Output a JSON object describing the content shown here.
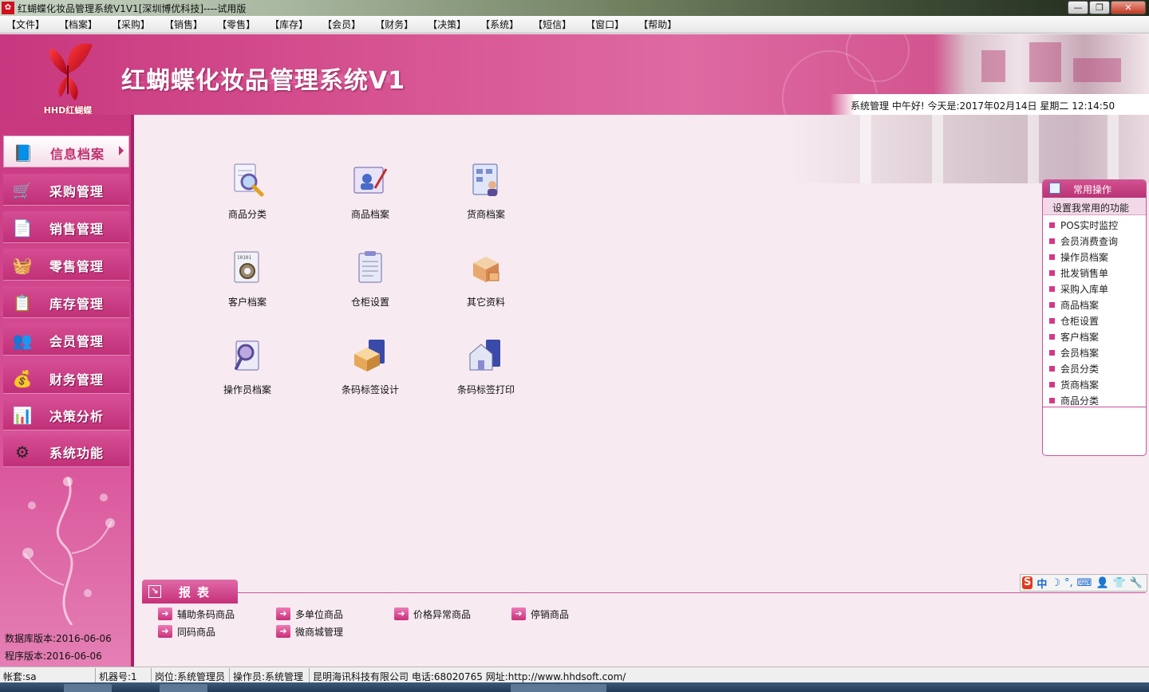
{
  "window": {
    "title": "红蝴蝶化妆品管理系统V1V1[深圳博优科技]----试用版",
    "minimize": "—",
    "maximize": "❐",
    "close": "✕"
  },
  "menubar": {
    "items": [
      "【文件】",
      "【档案】",
      "【采购】",
      "【销售】",
      "【零售】",
      "【库存】",
      "【会员】",
      "【财务】",
      "【决策】",
      "【系统】",
      "【短信】",
      "【窗口】",
      "【帮助】"
    ]
  },
  "header": {
    "logo_text": "HHD红蝴蝶",
    "app_title": "红蝴蝶化妆品管理系统V1",
    "greeting": "系统管理 中午好! 今天是:2017年02月14日 星期二 12:14:50"
  },
  "sidebar": {
    "items": [
      {
        "label": "信息档案",
        "icon": "file-user-icon"
      },
      {
        "label": "采购管理",
        "icon": "cart-icon"
      },
      {
        "label": "销售管理",
        "icon": "document-icon"
      },
      {
        "label": "零售管理",
        "icon": "basket-icon"
      },
      {
        "label": "库存管理",
        "icon": "clipboard-icon"
      },
      {
        "label": "会员管理",
        "icon": "users-icon"
      },
      {
        "label": "财务管理",
        "icon": "coins-icon"
      },
      {
        "label": "决策分析",
        "icon": "chart-icon"
      },
      {
        "label": "系统功能",
        "icon": "gear-icon"
      }
    ],
    "db_version": "数据库版本:2016-06-06",
    "program_version": "程序版本:2016-06-06"
  },
  "main": {
    "items": [
      {
        "label": "商品分类",
        "icon": "search-doc-icon"
      },
      {
        "label": "商品档案",
        "icon": "edit-doc-icon"
      },
      {
        "label": "货商档案",
        "icon": "supplier-icon"
      },
      {
        "label": "客户档案",
        "icon": "customer-gear-icon"
      },
      {
        "label": "仓柜设置",
        "icon": "warehouse-doc-icon"
      },
      {
        "label": "其它资料",
        "icon": "boxes-icon"
      },
      {
        "label": "操作员档案",
        "icon": "operator-search-icon"
      },
      {
        "label": "条码标签设计",
        "icon": "barcode-design-icon"
      },
      {
        "label": "条码标签打印",
        "icon": "barcode-print-icon"
      }
    ]
  },
  "common_ops": {
    "title": "常用操作",
    "subtitle": "设置我常用的功能",
    "items": [
      "POS实时监控",
      "会员消费查询",
      "操作员档案",
      "批发销售单",
      "采购入库单",
      "商品档案",
      "仓柜设置",
      "客户档案",
      "会员档案",
      "会员分类",
      "货商档案",
      "商品分类"
    ]
  },
  "ime": {
    "s": "S",
    "cn": "中",
    "moon": "☽",
    "dot": "°,",
    "keyboard": "⌨",
    "person": "👤",
    "shirt": "👕",
    "wrench": "🔧"
  },
  "reports": {
    "tab_label": "报表",
    "corner_icon": "↘",
    "items": [
      "辅助条码商品",
      "多单位商品",
      "价格异常商品",
      "停销商品",
      "同码商品",
      "微商城管理"
    ]
  },
  "statusbar": {
    "account": "帐套:sa",
    "machine": "机器号:1",
    "post": "岗位:系统管理员",
    "operator": "操作员:系统管理",
    "company": "昆明海讯科技有限公司 电话:68020765 网址:http://www.hhdsoft.com/"
  },
  "colors": {
    "accent": "#c8377f",
    "sidebar_dark": "#a82065",
    "bullet": "#d23a87"
  }
}
